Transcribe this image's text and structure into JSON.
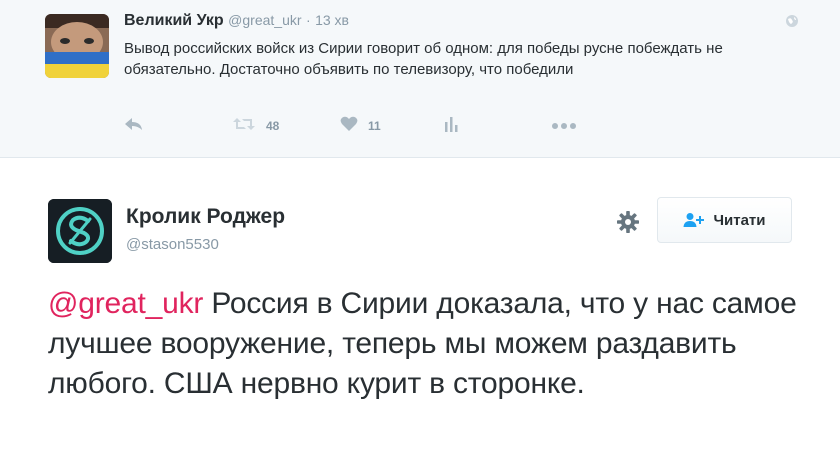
{
  "top_tweet": {
    "author_name": "Великий Укр",
    "author_handle": "@great_ukr",
    "separator": "·",
    "time": "13 хв",
    "text": "Вывод российских войск из Сирии говорит об одном: для победы русне побеждать не обязательно. Достаточно объявить по телевизору, что победили",
    "retweet_count": "48",
    "like_count": "11",
    "icons": [
      "reply-icon",
      "retweet-icon",
      "like-icon",
      "analytics-icon",
      "more-icon",
      "globe-icon"
    ]
  },
  "main_tweet": {
    "author_name": "Кролик Роджер",
    "author_handle": "@stason5530",
    "follow_label": "Читати",
    "mention": "@great_ukr",
    "text": " Россия в Сирии доказала, что у нас самое лучшее вооружение, теперь мы можем раздавить любого. США нервно курит в сторонке.",
    "icons": [
      "gear-icon",
      "follow-person-icon"
    ]
  },
  "colors": {
    "mention": "#e0245e",
    "muted": "#8899a6",
    "text": "#292f33",
    "top_background": "#f5f8fa",
    "follow_icon": "#1da1f2",
    "avatar_ring": "#4fd1c5"
  }
}
